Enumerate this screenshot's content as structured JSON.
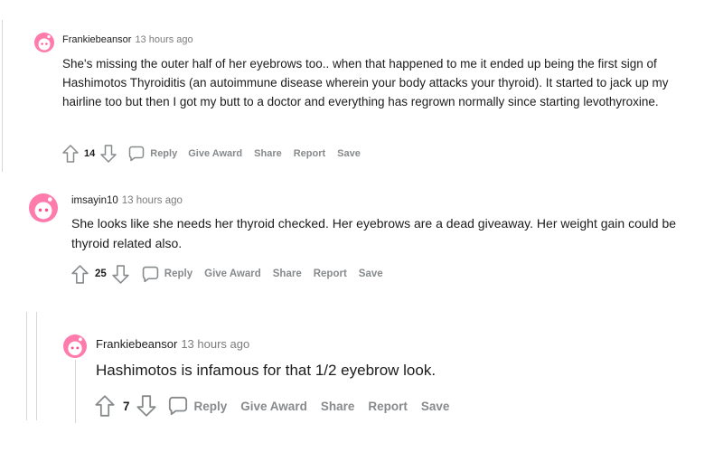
{
  "comments": [
    {
      "username": "Frankiebeansor",
      "time": "13 hours ago",
      "body": "She's missing the outer half of her eyebrows too.. when that happened to me it ended up being the first sign of Hashimotos Thyroiditis (an autoimmune disease wherein your body attacks your thyroid). It started to jack up my hairline too but then I got my butt to a doctor and everything has regrown normally since starting levothyroxine.",
      "score": "14",
      "actions": {
        "reply": "Reply",
        "award": "Give Award",
        "share": "Share",
        "report": "Report",
        "save": "Save"
      }
    },
    {
      "username": "imsayin10",
      "time": "13 hours ago",
      "body": "She looks like she needs her thyroid checked. Her eyebrows are a dead giveaway. Her weight gain could be thyroid related also.",
      "score": "25",
      "actions": {
        "reply": "Reply",
        "award": "Give Award",
        "share": "Share",
        "report": "Report",
        "save": "Save"
      }
    },
    {
      "username": "Frankiebeansor",
      "time": "13 hours ago",
      "body": "Hashimotos is infamous for that 1/2 eyebrow look.",
      "score": "7",
      "actions": {
        "reply": "Reply",
        "award": "Give Award",
        "share": "Share",
        "report": "Report",
        "save": "Save"
      }
    }
  ],
  "icons": {
    "upvote": "arrow-up-icon",
    "downvote": "arrow-down-icon",
    "reply": "speech-bubble-icon",
    "avatar": "snoo-avatar-icon"
  },
  "colors": {
    "avatar_pink": "#ff7bac",
    "action_gray": "#878a8c",
    "meta_gray": "#7c7c7c",
    "thread_line": "#d6d6d6"
  }
}
